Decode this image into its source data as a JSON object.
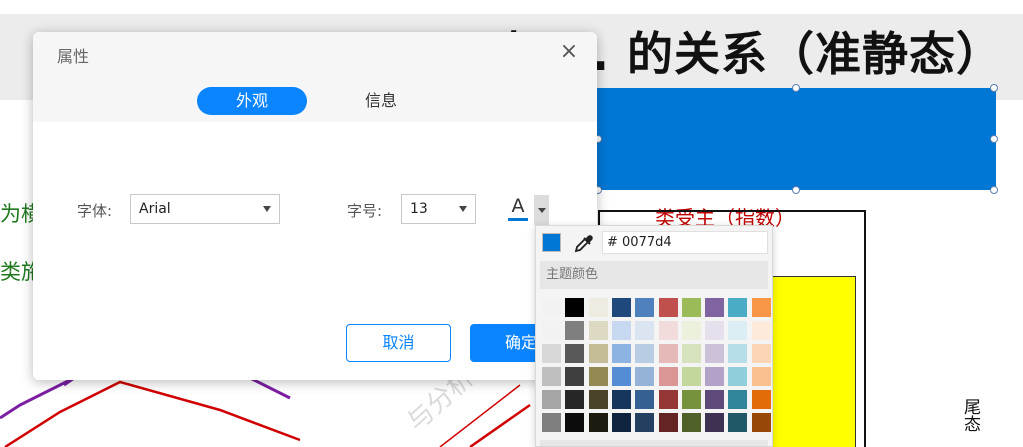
{
  "slide": {
    "title": "态 ... 的关系（准静态）",
    "green_line_1": "为横",
    "green_line_2": "类施",
    "red_label": "类受主（指数）",
    "vertical_label": "尾态",
    "watermark": "与分析"
  },
  "dialog": {
    "title": "属性",
    "close_glyph": "×",
    "tabs": [
      {
        "label": "外观",
        "active": true
      },
      {
        "label": "信息",
        "active": false
      }
    ],
    "font_label": "字体:",
    "font_value": "Arial",
    "size_label": "字号:",
    "size_value": "13",
    "font_color_glyph": "A",
    "cancel_label": "取消",
    "ok_label": "确定"
  },
  "color_picker": {
    "current_color": "#0077d4",
    "hex_value": "# 0077d4",
    "theme_label": "主题颜色",
    "rows": [
      [
        "#f2f2f2",
        "#000000",
        "#eeece1",
        "#1f497d",
        "#4f81bd",
        "#c0504d",
        "#9bbb59",
        "#8064a2",
        "#4bacc6",
        "#f79646"
      ],
      [
        "#f2f2f2",
        "#7f7f7f",
        "#ddd9c3",
        "#c6d9f0",
        "#dbe5f1",
        "#f2dcdb",
        "#ebf1dd",
        "#e5e0ec",
        "#dbeef3",
        "#fdeada"
      ],
      [
        "#d8d8d8",
        "#595959",
        "#c4bd97",
        "#8db3e2",
        "#b8cce4",
        "#e5b9b7",
        "#d7e3bc",
        "#ccc1d9",
        "#b7dde8",
        "#fbd5b5"
      ],
      [
        "#bfbfbf",
        "#3f3f3f",
        "#938953",
        "#548dd4",
        "#95b3d7",
        "#d99694",
        "#c3d69b",
        "#b2a2c7",
        "#92cddc",
        "#fac08f"
      ],
      [
        "#a5a5a5",
        "#262626",
        "#494429",
        "#17365d",
        "#366092",
        "#953734",
        "#76923c",
        "#5f497a",
        "#31859b",
        "#e36c09"
      ],
      [
        "#7f7f7f",
        "#0c0c0c",
        "#1d1b10",
        "#0f243e",
        "#244061",
        "#632423",
        "#4f6128",
        "#3f3151",
        "#205867",
        "#974806"
      ]
    ]
  },
  "colors": {
    "accent": "#0a84ff",
    "selection_fill": "#0077d4",
    "highlight": "#ffff00"
  }
}
